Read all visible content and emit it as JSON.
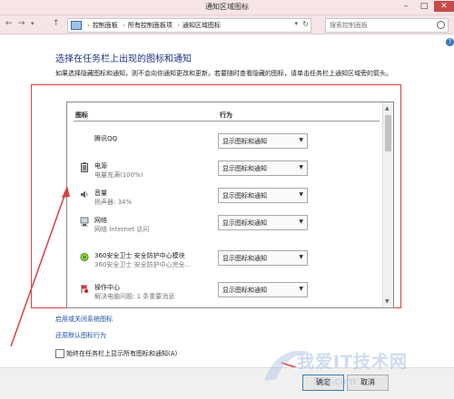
{
  "window": {
    "title": "通知区域图标"
  },
  "address": {
    "crumbs": [
      "控制面板",
      "所有控制面板项",
      "通知区域图标"
    ]
  },
  "search": {
    "placeholder": "搜索控制面板"
  },
  "heading": "选择在任务栏上出现的图标和通知",
  "description": "如果选择隐藏图标和通知，则不会向你通知更改和更新。若要随时查看隐藏的图标，请单击任务栏上通知区域旁的箭头。",
  "table": {
    "col_icon": "图标",
    "col_behavior": "行为",
    "rows": [
      {
        "name": "腾讯QQ",
        "sub": "",
        "icon": "qq-icon",
        "behavior": "显示图标和通知"
      },
      {
        "name": "电源",
        "sub": "电量充满(100%)",
        "icon": "battery-icon",
        "behavior": "显示图标和通知"
      },
      {
        "name": "音量",
        "sub": "扬声器: 34%",
        "icon": "speaker-icon",
        "behavior": "显示图标和通知"
      },
      {
        "name": "网络",
        "sub": "网络 Internet 访问",
        "icon": "network-icon",
        "behavior": "显示图标和通知"
      },
      {
        "name": "360安全卫士 安全防护中心模块",
        "sub": "360安全卫士 安全防护中心完全...",
        "icon": "360-icon",
        "behavior": "显示图标和通知"
      },
      {
        "name": "操作中心",
        "sub": "解决电脑问题: 1 条重要消息",
        "icon": "flag-icon",
        "behavior": "显示图标和通知"
      }
    ]
  },
  "links": {
    "system_icons": "启用或关闭系统图标",
    "restore": "还原默认图标行为"
  },
  "checkbox": {
    "label": "始终在任务栏上显示所有图标和通知(A)"
  },
  "buttons": {
    "ok": "确定",
    "cancel": "取消"
  },
  "watermark": {
    "text": "我爱IT技术网",
    "sub": "52ij.com"
  }
}
